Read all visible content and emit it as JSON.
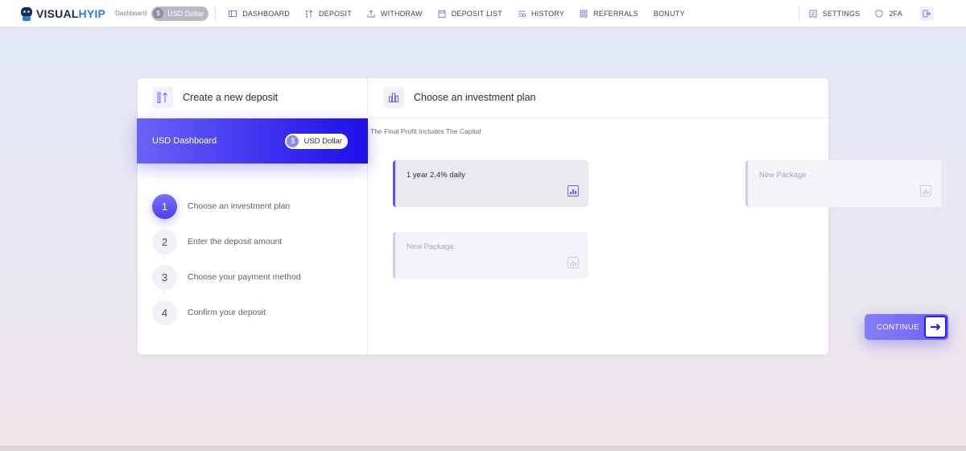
{
  "brand": {
    "part1": "VISUAL",
    "part2": "HYIP"
  },
  "topbar": {
    "dashboard_label": "Dashboard",
    "currency": "USD Dollar",
    "nav": [
      {
        "label": "DASHBOARD",
        "icon": "dashboard-icon"
      },
      {
        "label": "DEPOSIT",
        "icon": "deposit-icon"
      },
      {
        "label": "WITHDRAW",
        "icon": "withdraw-icon"
      },
      {
        "label": "DEPOSIT LIST",
        "icon": "deposit-list-icon"
      },
      {
        "label": "HISTORY",
        "icon": "history-icon"
      },
      {
        "label": "REFERRALS",
        "icon": "referrals-icon"
      },
      {
        "label": "BONUTY",
        "icon": ""
      }
    ],
    "settings": "SETTINGS",
    "twofa": "2FA"
  },
  "left": {
    "title": "Create a new deposit",
    "banner_label": "USD Dashboard",
    "banner_currency": "USD Dollar",
    "steps": [
      {
        "num": "1",
        "label": "Choose an investment plan",
        "active": true
      },
      {
        "num": "2",
        "label": "Enter the deposit amount",
        "active": false
      },
      {
        "num": "3",
        "label": "Choose your payment method",
        "active": false
      },
      {
        "num": "4",
        "label": "Confirm your deposit",
        "active": false
      }
    ]
  },
  "right": {
    "title": "Choose an investment plan",
    "note": "The Final Profit Includes The Capital",
    "packages": [
      {
        "label": "1 year 2.4% daily",
        "selected": true
      },
      {
        "label": "New Package",
        "selected": false
      },
      {
        "label": "New Package",
        "selected": false
      }
    ],
    "continue_label": "CONTINUE"
  },
  "colors": {
    "accent": "#5a52f2",
    "accent_dark": "#1c10e8"
  }
}
